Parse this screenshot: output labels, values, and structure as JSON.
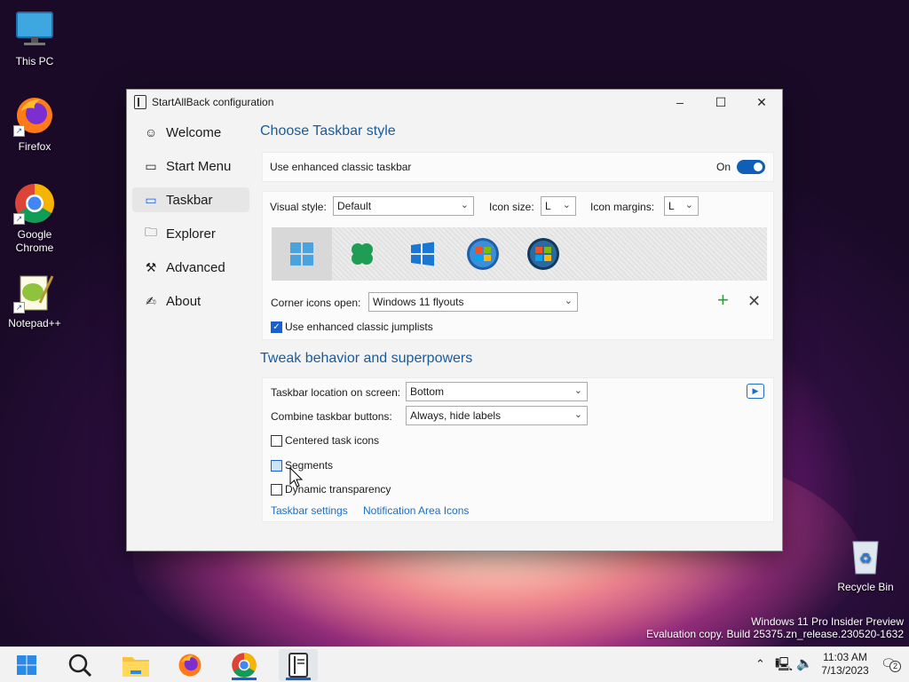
{
  "desktop": {
    "icons": [
      {
        "label": "This PC",
        "icon": "monitor-icon"
      },
      {
        "label": "Firefox",
        "icon": "firefox-icon"
      },
      {
        "label": "Google Chrome",
        "icon": "chrome-icon"
      },
      {
        "label": "Notepad++",
        "icon": "notepadpp-icon"
      },
      {
        "label": "Recycle Bin",
        "icon": "recycle-bin-icon"
      }
    ],
    "watermark": {
      "line1": "Windows 11 Pro Insider Preview",
      "line2": "Evaluation copy. Build 25375.zn_release.230520-1632"
    }
  },
  "window": {
    "title": "StartAllBack configuration",
    "controls": {
      "minimize": "–",
      "maximize": "☐",
      "close": "✕"
    },
    "nav": [
      {
        "label": "Welcome",
        "icon": "smiley-icon",
        "active": false
      },
      {
        "label": "Start Menu",
        "icon": "start-menu-icon",
        "active": false
      },
      {
        "label": "Taskbar",
        "icon": "taskbar-icon",
        "active": true
      },
      {
        "label": "Explorer",
        "icon": "folder-icon",
        "active": false
      },
      {
        "label": "Advanced",
        "icon": "wrench-icon",
        "active": false
      },
      {
        "label": "About",
        "icon": "signature-icon",
        "active": false
      }
    ],
    "section1": {
      "title": "Choose Taskbar style",
      "enhanced_label": "Use enhanced classic taskbar",
      "toggle_label": "On",
      "toggle_on": true,
      "visual_style_label": "Visual style:",
      "visual_style_value": "Default",
      "icon_size_label": "Icon size:",
      "icon_size_value": "L",
      "icon_margins_label": "Icon margins:",
      "icon_margins_value": "L",
      "styles": [
        "windows11-style-icon",
        "clover-style-icon",
        "windows10-style-icon",
        "windows7-orb-icon",
        "windows-vista-orb-icon"
      ],
      "corner_label": "Corner icons open:",
      "corner_value": "Windows 11 flyouts",
      "jumplists_label": "Use enhanced classic jumplists",
      "jumplists_checked": true
    },
    "section2": {
      "title": "Tweak behavior and superpowers",
      "location_label": "Taskbar location on screen:",
      "location_value": "Bottom",
      "combine_label": "Combine taskbar buttons:",
      "combine_value": "Always, hide labels",
      "centered_label": "Centered task icons",
      "segments_label": "Segments",
      "dynamic_label": "Dynamic transparency",
      "link1": "Taskbar settings",
      "link2": "Notification Area Icons"
    }
  },
  "taskbar": {
    "items": [
      "start-icon",
      "search-icon",
      "file-explorer-icon",
      "firefox-icon",
      "chrome-icon",
      "startallback-icon"
    ],
    "time": "11:03 AM",
    "date": "7/13/2023",
    "notification_count": "2"
  }
}
